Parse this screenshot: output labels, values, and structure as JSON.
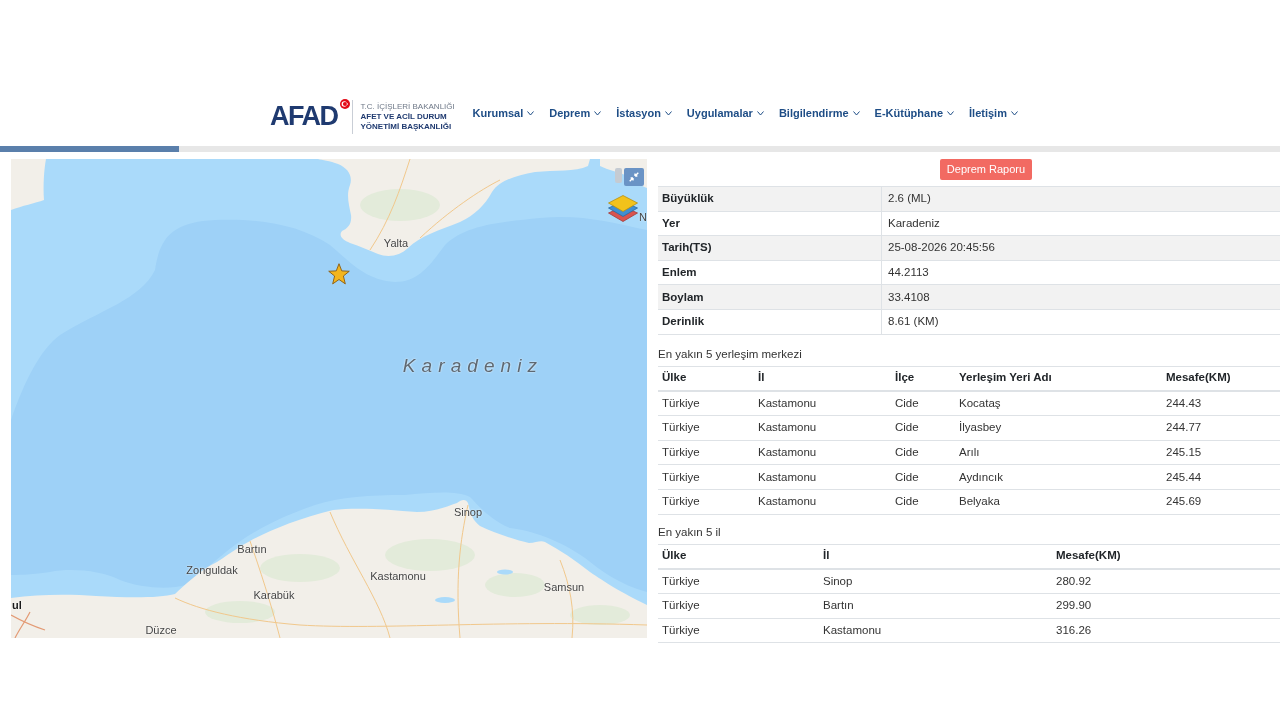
{
  "header": {
    "logo": {
      "wordmark": "AFAD",
      "ministry": "T.C. İÇİŞLERİ BAKANLIĞI",
      "agency": [
        "AFET VE ACİL DURUM",
        "YÖNETİMİ BAŞKANLIĞI"
      ]
    },
    "nav": [
      {
        "label": "Kurumsal"
      },
      {
        "label": "Deprem"
      },
      {
        "label": "İstasyon"
      },
      {
        "label": "Uygulamalar"
      },
      {
        "label": "Bilgilendirme"
      },
      {
        "label": "E-Kütüphane"
      },
      {
        "label": "İletişim"
      }
    ]
  },
  "loading_bar": {
    "level": 0.14
  },
  "map": {
    "labels": [
      {
        "text": "N",
        "kind": "place"
      },
      {
        "text": "Yalta",
        "kind": "place"
      },
      {
        "text": "Karadeniz",
        "kind": "sea"
      },
      {
        "text": "Sinop",
        "kind": "place"
      },
      {
        "text": "Bartın",
        "kind": "place"
      },
      {
        "text": "Zonguldak",
        "kind": "place"
      },
      {
        "text": "Kastamonu",
        "kind": "place"
      },
      {
        "text": "Samsun",
        "kind": "place"
      },
      {
        "text": "Karabük",
        "kind": "place"
      },
      {
        "text": "ul",
        "kind": "capital"
      },
      {
        "text": "Düzce",
        "kind": "place"
      }
    ]
  },
  "report_button": {
    "label": "Deprem Raporu"
  },
  "details": [
    {
      "label": "Büyüklük",
      "value": "2.6 (ML)"
    },
    {
      "label": "Yer",
      "value": "Karadeniz"
    },
    {
      "label": "Tarih(TS)",
      "value": "25-08-2026 20:45:56"
    },
    {
      "label": "Enlem",
      "value": "44.2113"
    },
    {
      "label": "Boylam",
      "value": "33.4108"
    },
    {
      "label": "Derinlik",
      "value": "8.61 (KM)"
    }
  ],
  "nearest_settlements": {
    "title": "En yakın 5 yerleşim merkezi",
    "columns": [
      "Ülke",
      "İl",
      "İlçe",
      "Yerleşim Yeri Adı",
      "Mesafe(KM)"
    ],
    "rows": [
      [
        "Türkiye",
        "Kastamonu",
        "Cide",
        "Kocataş",
        "244.43"
      ],
      [
        "Türkiye",
        "Kastamonu",
        "Cide",
        "İlyasbey",
        "244.77"
      ],
      [
        "Türkiye",
        "Kastamonu",
        "Cide",
        "Arılı",
        "245.15"
      ],
      [
        "Türkiye",
        "Kastamonu",
        "Cide",
        "Aydıncık",
        "245.44"
      ],
      [
        "Türkiye",
        "Kastamonu",
        "Cide",
        "Belyaka",
        "245.69"
      ]
    ]
  },
  "nearest_provinces": {
    "title": "En yakın 5 il",
    "columns": [
      "Ülke",
      "İl",
      "Mesafe(KM)"
    ],
    "rows": [
      [
        "Türkiye",
        "Sinop",
        "280.92"
      ],
      [
        "Türkiye",
        "Bartın",
        "299.90"
      ],
      [
        "Türkiye",
        "Kastamonu",
        "316.26"
      ]
    ]
  }
}
